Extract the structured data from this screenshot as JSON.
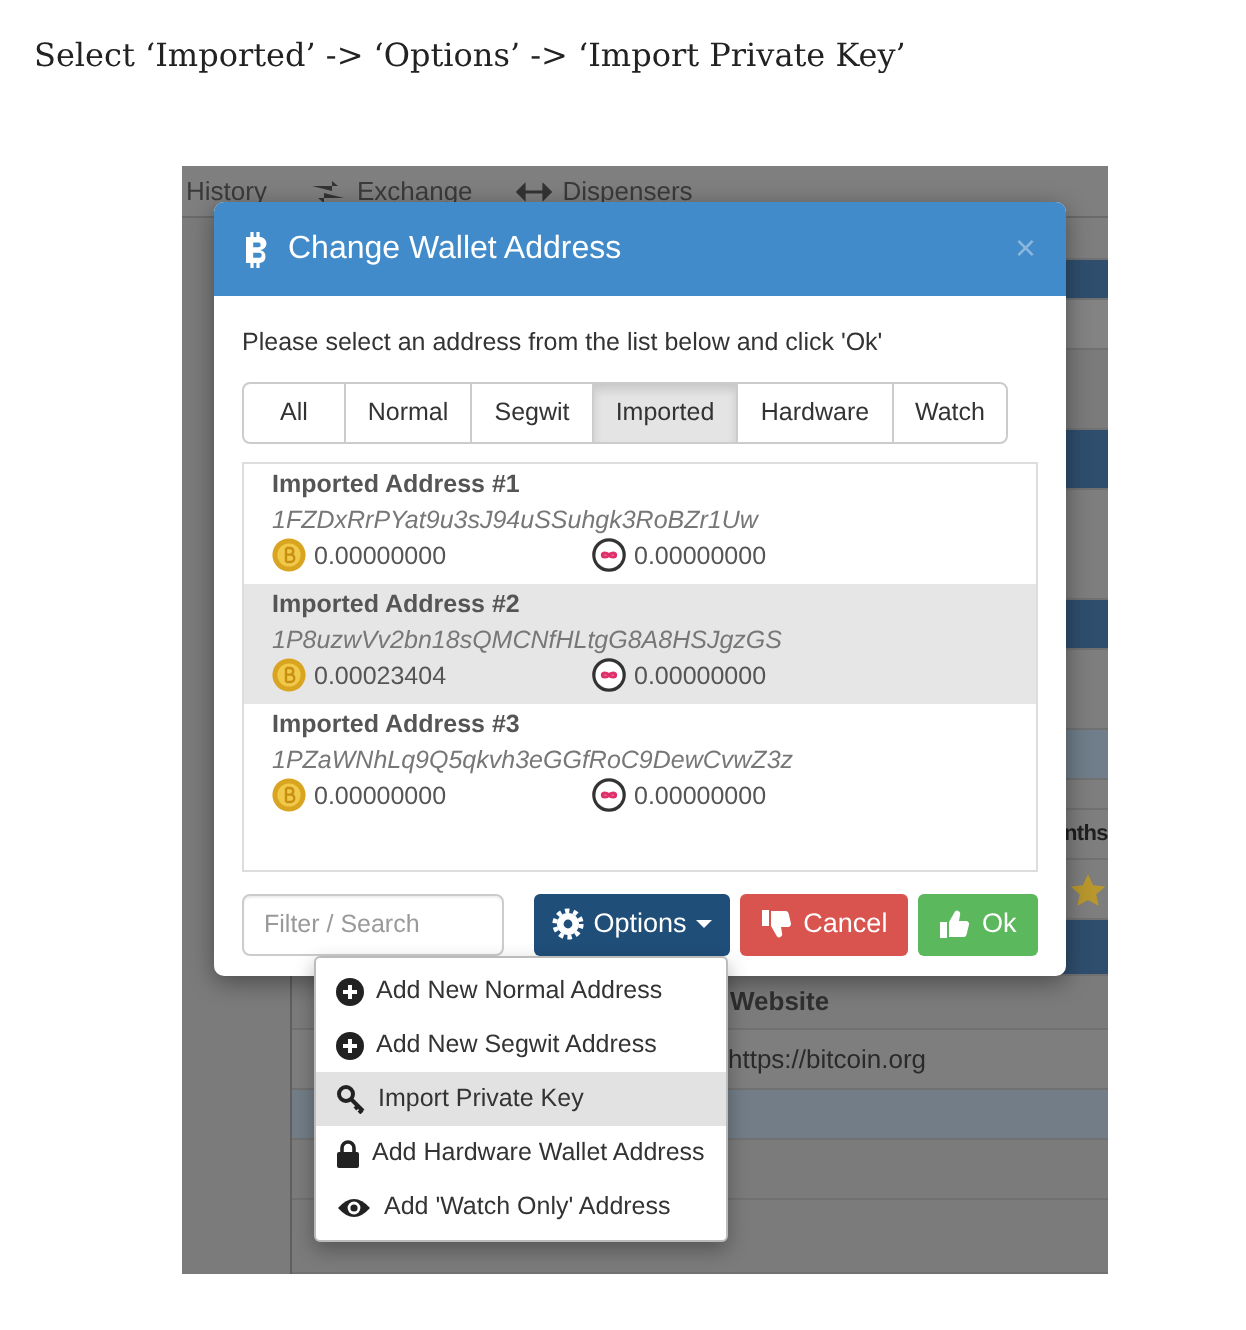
{
  "caption": "Select ‘Imported’ -> ‘Options’ -> ‘Import Private Key’",
  "background": {
    "nav": [
      {
        "label": "History",
        "kind": "plain"
      },
      {
        "label": "Exchange",
        "kind": "exchange"
      },
      {
        "label": "Dispensers",
        "kind": "dispensers"
      }
    ],
    "column_header": "nths",
    "table_header": "Website",
    "table_cell": "https://bitcoin.org"
  },
  "modal": {
    "title": "Change Wallet Address",
    "close": "×",
    "prompt": "Please select an address from the list below and click 'Ok'",
    "tabs": [
      {
        "label": "All",
        "selected": false
      },
      {
        "label": "Normal",
        "selected": false
      },
      {
        "label": "Segwit",
        "selected": false
      },
      {
        "label": "Imported",
        "selected": true
      },
      {
        "label": "Hardware",
        "selected": false
      },
      {
        "label": "Watch",
        "selected": false
      }
    ],
    "addresses": [
      {
        "name": "Imported Address #1",
        "address": "1FZDxRrPYat9u3sJ94uSSuhgk3RoBZr1Uw",
        "btc": "0.00000000",
        "xcp": "0.00000000",
        "selected": false
      },
      {
        "name": "Imported Address #2",
        "address": "1P8uzwVv2bn18sQMCNfHLtgG8A8HSJgzGS",
        "btc": "0.00023404",
        "xcp": "0.00000000",
        "selected": true
      },
      {
        "name": "Imported Address #3",
        "address": "1PZaWNhLq9Q5qkvh3eGGfRoC9DewCvwZ3z",
        "btc": "0.00000000",
        "xcp": "0.00000000",
        "selected": false
      }
    ],
    "search": {
      "placeholder": "Filter / Search"
    },
    "buttons": [
      {
        "kind": "options",
        "label": "Options"
      },
      {
        "kind": "cancel",
        "label": "Cancel"
      },
      {
        "kind": "ok",
        "label": "Ok"
      }
    ]
  },
  "menu": [
    {
      "kind": "plus",
      "label": "Add New Normal Address",
      "selected": false
    },
    {
      "kind": "plus",
      "label": "Add New Segwit Address",
      "selected": false
    },
    {
      "kind": "key",
      "label": "Import Private Key",
      "selected": true
    },
    {
      "kind": "lock",
      "label": "Add Hardware Wallet Address",
      "selected": false
    },
    {
      "kind": "eye",
      "label": "Add 'Watch Only' Address",
      "selected": false
    }
  ]
}
